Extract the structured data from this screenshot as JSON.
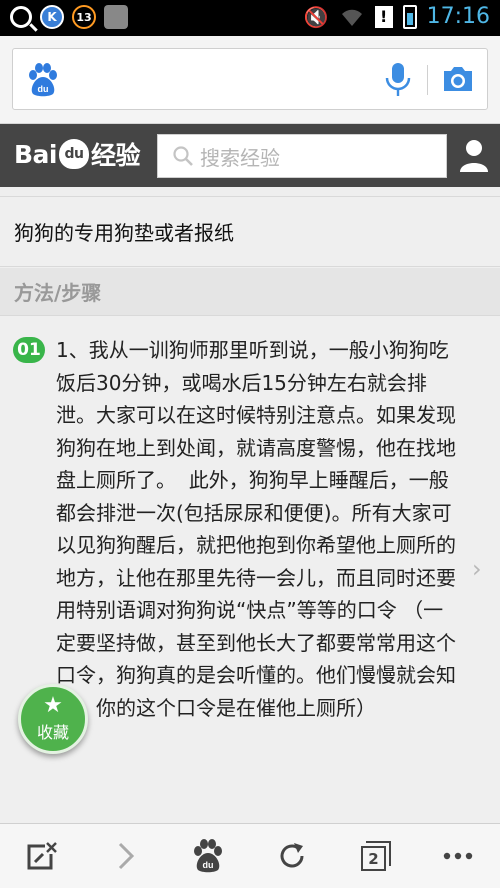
{
  "status_bar": {
    "time": "17:16",
    "badge_k": "K",
    "badge_count": "13",
    "icons": [
      "search-icon",
      "k-app-icon",
      "notification-13-icon",
      "app-icon",
      "mute-icon",
      "wifi-icon",
      "alert-icon",
      "battery-icon"
    ]
  },
  "browser": {
    "address_value": "",
    "icons": [
      "baidu-paw-icon",
      "microphone-icon",
      "camera-icon"
    ]
  },
  "site_header": {
    "logo_bai": "Bai",
    "logo_du": "du",
    "logo_jingyan": "经验",
    "search_placeholder": "搜索经验"
  },
  "content": {
    "item_line": "狗狗的专用狗垫或者报纸",
    "section_title": "方法/步骤",
    "step_number": "01",
    "step_text": "1、我从一训狗师那里听到说，一般小狗狗吃饭后30分钟，或喝水后15分钟左右就会排泄。大家可以在这时候特别注意点。如果发现狗狗在地上到处闻，就请高度警惕，他在找地盘上厕所了。  此外，狗狗早上睡醒后，一般都会排泄一次(包括尿尿和便便)。所有大家可以见狗狗醒后，就把他抱到你希望他上厕所的地方，让他在那里先待一会儿，而且同时还要用特别语调对狗狗说“快点”等等的口令 （一定要坚持做，甚至到他长大了都要常常用这个口令，狗狗真的是会听懂的。他们慢慢就会知道，你的这个口令是在催他上厕所）",
    "favorite_label": "收藏"
  },
  "toolbar": {
    "tabs_count": "2",
    "icons": [
      "close-tab-icon",
      "forward-icon",
      "baidu-home-icon",
      "refresh-icon",
      "tabs-icon",
      "more-icon"
    ]
  },
  "colors": {
    "accent_green": "#39b54a",
    "time_blue": "#4fb7e6",
    "header_dark": "#454545"
  }
}
